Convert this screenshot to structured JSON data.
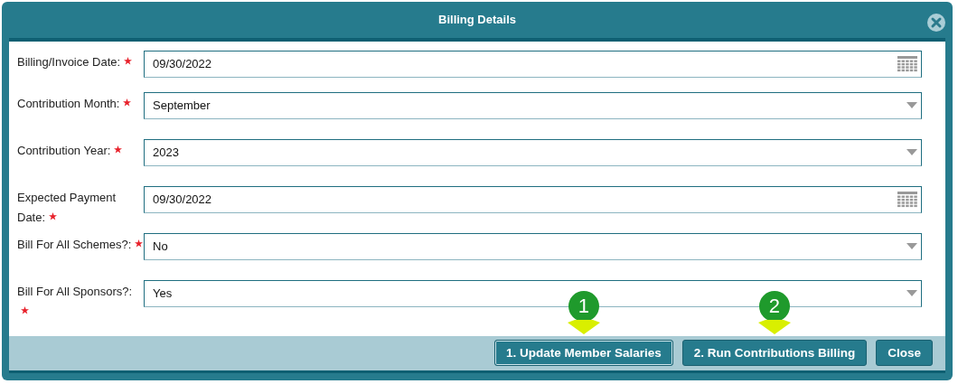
{
  "window": {
    "title": "Billing Details"
  },
  "fields": [
    {
      "label": "Billing/Invoice Date:",
      "required": true,
      "kind": "date",
      "value": "09/30/2022"
    },
    {
      "label": "Contribution Month:",
      "required": true,
      "kind": "select",
      "value": "September"
    },
    {
      "label": "Contribution Year:",
      "required": true,
      "kind": "select",
      "value": "2023"
    },
    {
      "label": "Expected Payment Date:",
      "required": true,
      "kind": "date",
      "value": "09/30/2022"
    },
    {
      "label": "Bill For All Schemes?:",
      "required": true,
      "kind": "select",
      "value": "No"
    },
    {
      "label": "Bill For All Sponsors?:",
      "required": true,
      "kind": "select",
      "value": "Yes"
    }
  ],
  "buttons": [
    {
      "label": "1. Update Member Salaries",
      "callout": "1"
    },
    {
      "label": "2. Run Contributions Billing",
      "callout": "2"
    },
    {
      "label": "Close"
    }
  ]
}
